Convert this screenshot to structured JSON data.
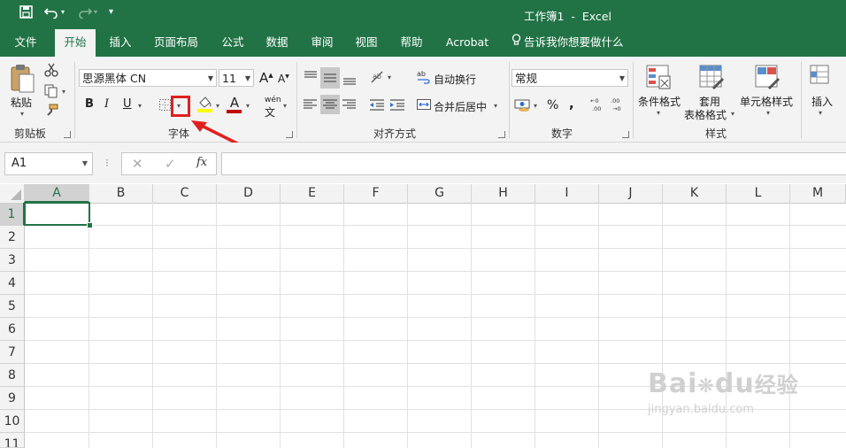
{
  "titlebar": {
    "title": "工作簿1  -  Excel",
    "save_icon": "save-icon",
    "undo_icon": "undo-icon",
    "redo_icon": "redo-icon",
    "customize_icon": "customize-qat-icon"
  },
  "tabs": [
    {
      "label": "文件"
    },
    {
      "label": "开始"
    },
    {
      "label": "插入"
    },
    {
      "label": "页面布局"
    },
    {
      "label": "公式"
    },
    {
      "label": "数据"
    },
    {
      "label": "审阅"
    },
    {
      "label": "视图"
    },
    {
      "label": "帮助"
    },
    {
      "label": "Acrobat"
    }
  ],
  "tell_me": "告诉我你想要做什么",
  "ribbon": {
    "clipboard": {
      "paste": "粘贴",
      "label": "剪贴板"
    },
    "font": {
      "font_name": "思源黑体 CN",
      "font_size": "11",
      "bold": "B",
      "italic": "I",
      "underline": "U",
      "grow": "A",
      "shrink": "A",
      "font_color_letter": "A",
      "phonetic": "wén",
      "label": "字体"
    },
    "alignment": {
      "wrap": "自动换行",
      "merge": "合并后居中",
      "label": "对齐方式"
    },
    "number": {
      "format": "常规",
      "percent": "%",
      "comma": ",",
      "label": "数字"
    },
    "styles": {
      "conditional": "条件格式",
      "table_1": "套用",
      "table_2": "表格格式",
      "cell_styles": "单元格样式",
      "label": "样式"
    },
    "cells": {
      "insert": "插入"
    }
  },
  "formula_bar": {
    "name_box": "A1",
    "fx": "fx",
    "formula": ""
  },
  "columns": [
    "A",
    "B",
    "C",
    "D",
    "E",
    "F",
    "G",
    "H",
    "I",
    "J",
    "K",
    "L",
    "M"
  ],
  "rows": [
    "1",
    "2",
    "3",
    "4",
    "5",
    "6",
    "7",
    "8",
    "9",
    "10",
    "11"
  ],
  "active_cell": "A1",
  "watermark": {
    "brand": "Bai",
    "brand_b": "du",
    "suffix": "经验",
    "url": "jingyan.baidu.com"
  },
  "colors": {
    "excel_green": "#217346",
    "highlight_red": "#e02020",
    "font_color_bar": "#c00000",
    "fill_color_bar": "#ffff00"
  }
}
